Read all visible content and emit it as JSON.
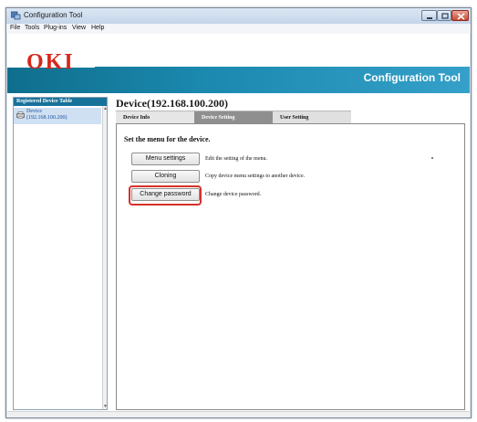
{
  "window": {
    "title": "Configuration Tool",
    "icon": "app-window-icon",
    "controls": {
      "minimize_icon": "minimize-icon",
      "maximize_icon": "maximize-icon",
      "close_icon": "close-icon"
    }
  },
  "menubar": {
    "items": [
      {
        "label": "File"
      },
      {
        "label": "Tools"
      },
      {
        "label": "Plug-ins"
      },
      {
        "label": "View"
      },
      {
        "label": "Help"
      }
    ]
  },
  "brand": {
    "logo_text": "OKI",
    "app_title": "Configuration Tool",
    "logo_color": "#d8261b",
    "accent_color": "#1c8ab0"
  },
  "sidebar": {
    "header": "Registered Device Table",
    "items": [
      {
        "name": "Device",
        "address": "(192.168.100.200)",
        "icon": "printer-icon"
      }
    ]
  },
  "main": {
    "device_heading": "Device(192.168.100.200)",
    "tabs": [
      {
        "label": "Device Info"
      },
      {
        "label": "Device Setting"
      },
      {
        "label": "User Setting"
      }
    ],
    "active_tab": "Device Setting",
    "section_title": "Set the menu for the device.",
    "actions": [
      {
        "label": "Menu settings",
        "description": "Edit the setting of the menu."
      },
      {
        "label": "Cloning",
        "description": "Copy device menu settings to another device."
      },
      {
        "label": "Change password",
        "description": "Change device password."
      }
    ],
    "highlight_color": "#d6312a"
  }
}
